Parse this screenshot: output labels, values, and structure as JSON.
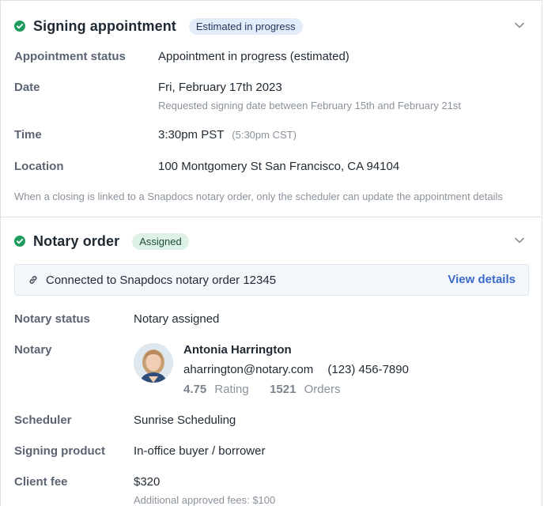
{
  "appointment": {
    "title": "Signing appointment",
    "badge": "Estimated in progress",
    "status_label": "Appointment status",
    "status_value": "Appointment in progress (estimated)",
    "date_label": "Date",
    "date_value": "Fri, February 17th 2023",
    "date_sub": "Requested signing date between February 15th and February 21st",
    "time_label": "Time",
    "time_value": "3:30pm PST",
    "time_sub": "(5:30pm CST)",
    "location_label": "Location",
    "location_value": "100 Montgomery St San Francisco, CA 94104",
    "note": "When a closing is linked to a Snapdocs notary order, only the scheduler can update the appointment details"
  },
  "notary_order": {
    "title": "Notary order",
    "badge": "Assigned",
    "notice_text": "Connected to Snapdocs notary order 12345",
    "view_details": "View details",
    "status_label": "Notary status",
    "status_value": "Notary assigned",
    "notary_label": "Notary",
    "notary_name": "Antonia Harrington",
    "notary_email": "aharrington@notary.com",
    "notary_phone": "(123) 456-7890",
    "rating_value": "4.75",
    "rating_label": "Rating",
    "orders_value": "1521",
    "orders_label": "Orders",
    "scheduler_label": "Scheduler",
    "scheduler_value": "Sunrise Scheduling",
    "product_label": "Signing product",
    "product_value": "In-office buyer / borrower",
    "fee_label": "Client fee",
    "fee_value": "$320",
    "fee_sub": "Additional approved fees: $100"
  },
  "colors": {
    "success": "#1f9d5c",
    "link": "#3b6bc9",
    "badge_blue_bg": "#e3edfa",
    "badge_green_bg": "#ddf1e6"
  },
  "icons": {
    "status": "check-circle-icon",
    "collapse": "chevron-down-icon",
    "connection": "link-icon"
  }
}
